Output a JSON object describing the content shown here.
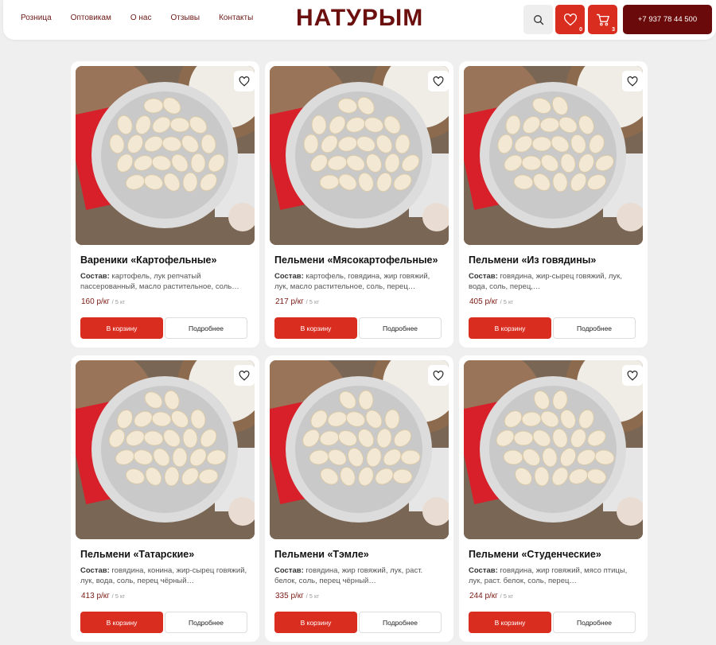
{
  "nav": [
    "Розница",
    "Оптовикам",
    "О нас",
    "Отзывы",
    "Контакты"
  ],
  "logo": "НАТУРЫМ",
  "header": {
    "fav_count": "0",
    "cart_count": "3",
    "phone": "+7 937 78 44 500"
  },
  "colors": {
    "accent": "#d92d20",
    "brand_dark": "#6b0a0a",
    "background": "#efefef"
  },
  "products": [
    {
      "title": "Вареники «Картофельные»",
      "comp_label": "Состав:",
      "comp_text": " картофель, лук репчатый пассерованный, масло растительное, соль…",
      "price": "160 р/кг",
      "unit": "/ 5 кг",
      "cart_label": "В корзину",
      "more_label": "Подробнее"
    },
    {
      "title": "Пельмени «Мясокартофельные»",
      "comp_label": "Состав:",
      "comp_text": " картофель, говядина, жир говяжий, лук, масло растительное, соль, перец…",
      "price": "217 р/кг",
      "unit": "/ 5 кг",
      "cart_label": "В корзину",
      "more_label": "Подробнее"
    },
    {
      "title": "Пельмени «Из говядины»",
      "comp_label": "Состав:",
      "comp_text": " говядина, жир-сырец говяжий, лук, вода, соль, перец,…",
      "price": "405 р/кг",
      "unit": "/ 5 кг",
      "cart_label": "В корзину",
      "more_label": "Подробнее"
    },
    {
      "title": "Пельмени «Татарские»",
      "comp_label": "Состав:",
      "comp_text": " говядина, конина, жир-сырец говяжий, лук, вода, соль, перец чёрный…",
      "price": "413 р/кг",
      "unit": "/ 5 кг",
      "cart_label": "В корзину",
      "more_label": "Подробнее"
    },
    {
      "title": "Пельмени «Тэмле»",
      "comp_label": "Состав:",
      "comp_text": " говядина, жир говяжий, лук, раст. белок, соль, перец чёрный…",
      "price": "335 р/кг",
      "unit": "/ 5 кг",
      "cart_label": "В корзину",
      "more_label": "Подробнее"
    },
    {
      "title": "Пельмени «Студенческие»",
      "comp_label": "Состав:",
      "comp_text": " говядина, жир говяжий, мясо птицы, лук, раст. белок, соль, перец…",
      "price": "244 р/кг",
      "unit": "/ 5 кг",
      "cart_label": "В корзину",
      "more_label": "Подробнее"
    }
  ]
}
